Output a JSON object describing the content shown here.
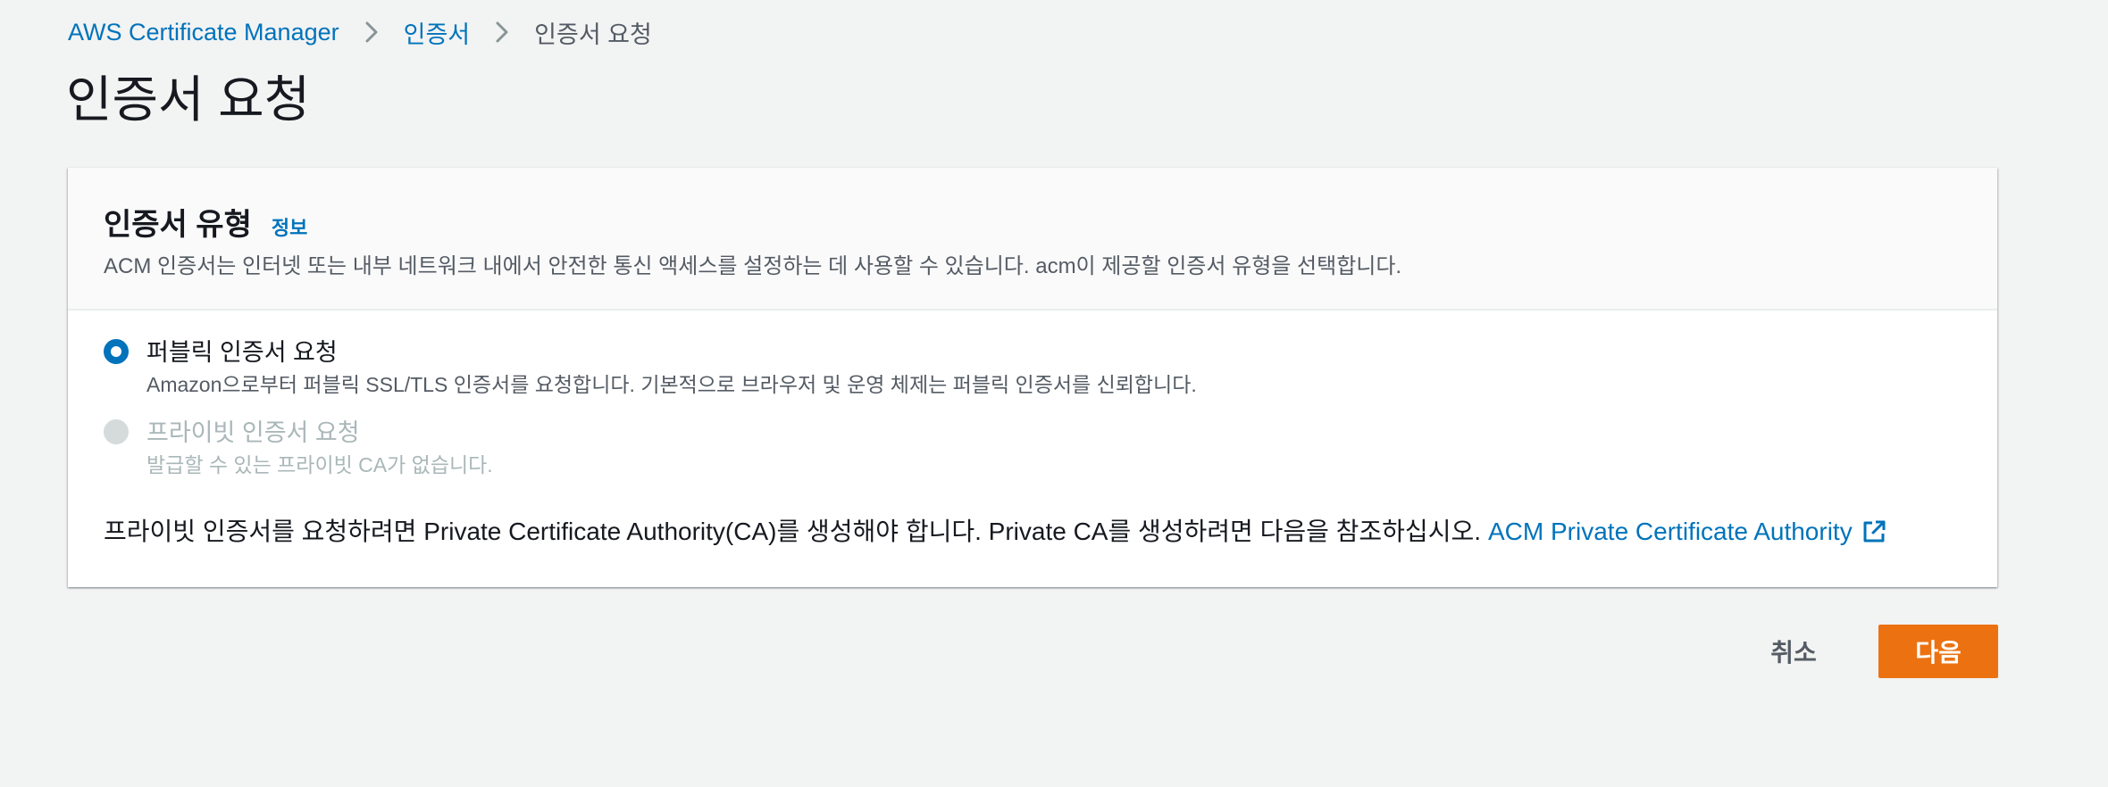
{
  "breadcrumb": {
    "items": [
      {
        "label": "AWS Certificate Manager"
      },
      {
        "label": "인증서"
      },
      {
        "label": "인증서 요청"
      }
    ]
  },
  "page": {
    "title": "인증서 요청"
  },
  "certificate_type": {
    "title": "인증서 유형",
    "info_link": "정보",
    "description": "ACM 인증서는 인터넷 또는 내부 네트워크 내에서 안전한 통신 액세스를 설정하는 데 사용할 수 있습니다. acm이 제공할 인증서 유형을 선택합니다.",
    "options": [
      {
        "label": "퍼블릭 인증서 요청",
        "description": "Amazon으로부터 퍼블릭 SSL/TLS 인증서를 요청합니다. 기본적으로 브라우저 및 운영 체제는 퍼블릭 인증서를 신뢰합니다.",
        "selected": true,
        "disabled": false
      },
      {
        "label": "프라이빗 인증서 요청",
        "description": "발급할 수 있는 프라이빗 CA가 없습니다.",
        "selected": false,
        "disabled": true
      }
    ],
    "note_text": "프라이빗 인증서를 요청하려면 Private Certificate Authority(CA)를 생성해야 합니다. Private CA를 생성하려면 다음을 참조하십시오.",
    "note_link": "ACM Private Certificate Authority"
  },
  "footer": {
    "cancel_label": "취소",
    "next_label": "다음"
  },
  "colors": {
    "link": "#0073bb",
    "primary_button": "#ec7211",
    "background": "#f2f3f3"
  },
  "icons": {
    "breadcrumb_separator": "chevron-right-icon",
    "external_link": "external-link-icon"
  }
}
